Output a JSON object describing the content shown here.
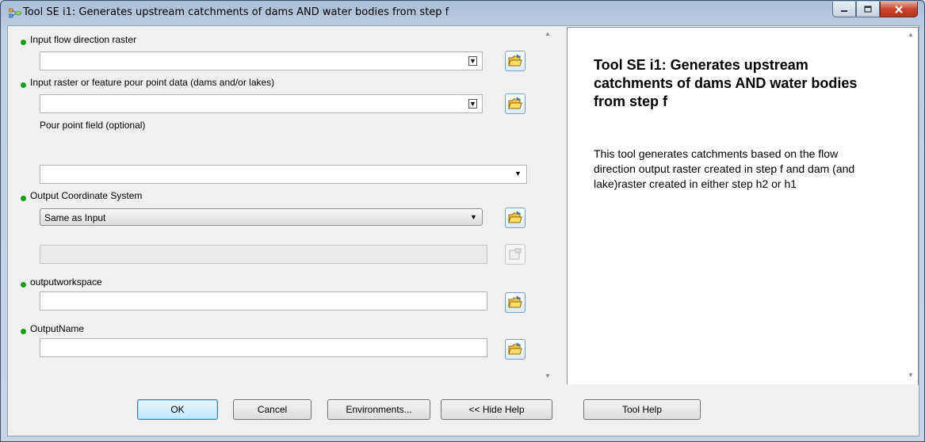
{
  "window": {
    "title": "Tool SE i1: Generates upstream catchments of dams AND water bodies from step f",
    "buttons": {
      "minimize": "minimize-icon",
      "maximize": "maximize-icon",
      "close": "close-icon"
    }
  },
  "form": {
    "input_flow": {
      "label": "Input flow direction raster",
      "value": ""
    },
    "input_pour": {
      "label": "Input raster or feature pour point data (dams and/or lakes)",
      "value": ""
    },
    "pour_field": {
      "label": "Pour point field (optional)",
      "value": ""
    },
    "output_cs": {
      "label": "Output Coordinate System",
      "value": "Same as Input"
    },
    "cs_detail": {
      "value": ""
    },
    "workspace": {
      "label": "outputworkspace",
      "value": ""
    },
    "output_name": {
      "label": "OutputName",
      "value": ""
    }
  },
  "help": {
    "title": "Tool SE i1: Generates upstream catchments of dams AND water bodies from step f",
    "body": "This tool generates catchments based on the flow direction output raster created in step f and dam (and lake)raster created in either step h2 or h1"
  },
  "footer": {
    "ok": "OK",
    "cancel": "Cancel",
    "environments": "Environments...",
    "hide_help": "<< Hide Help",
    "tool_help": "Tool Help"
  },
  "colors": {
    "required_dot": "#1b9a1b",
    "close_button": "#c8462f"
  }
}
